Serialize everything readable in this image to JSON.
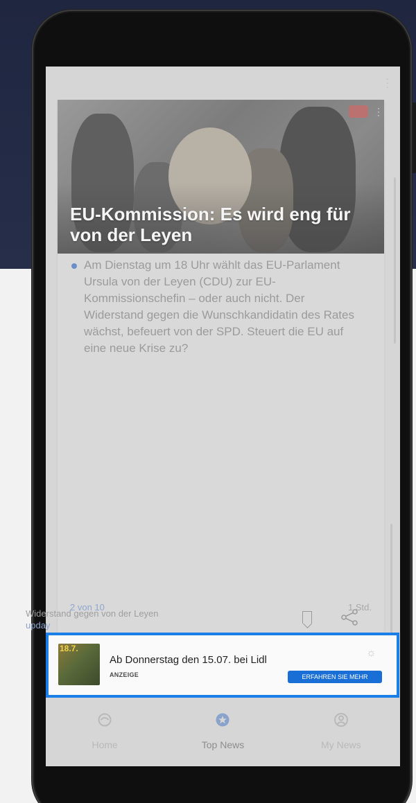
{
  "article": {
    "headline": "EU-Kommission: Es wird eng für von der Leyen",
    "summary": "Am Dienstag um 18 Uhr wählt das EU-Parlament Ursula von der Leyen (CDU) zur EU-Kommissionschefin – oder auch nicht. Der Widerstand gegen die Wunschkandidatin des Rates wächst, befeuert von der SPD. Steuert die EU auf eine neue Krise zu?",
    "counter": "2 von 10",
    "time": "1 Std."
  },
  "source": {
    "title": "Widerstand gegen von der Leyen",
    "name": "upday"
  },
  "ad": {
    "thumb_text": "18.7.",
    "title": "Ab Donnerstag den 15.07. bei Lidl",
    "label": "ANZEIGE",
    "cta": "ERFAHREN SIE MEHR"
  },
  "nav": {
    "items": [
      {
        "label": "Home",
        "icon": "home-icon"
      },
      {
        "label": "Top News",
        "icon": "top-news-icon"
      },
      {
        "label": "My News",
        "icon": "profile-icon"
      }
    ],
    "active": "Top News"
  },
  "colors": {
    "accent": "#1a7fe6",
    "link": "#8ea5cf",
    "cta": "#1a6fd6"
  }
}
